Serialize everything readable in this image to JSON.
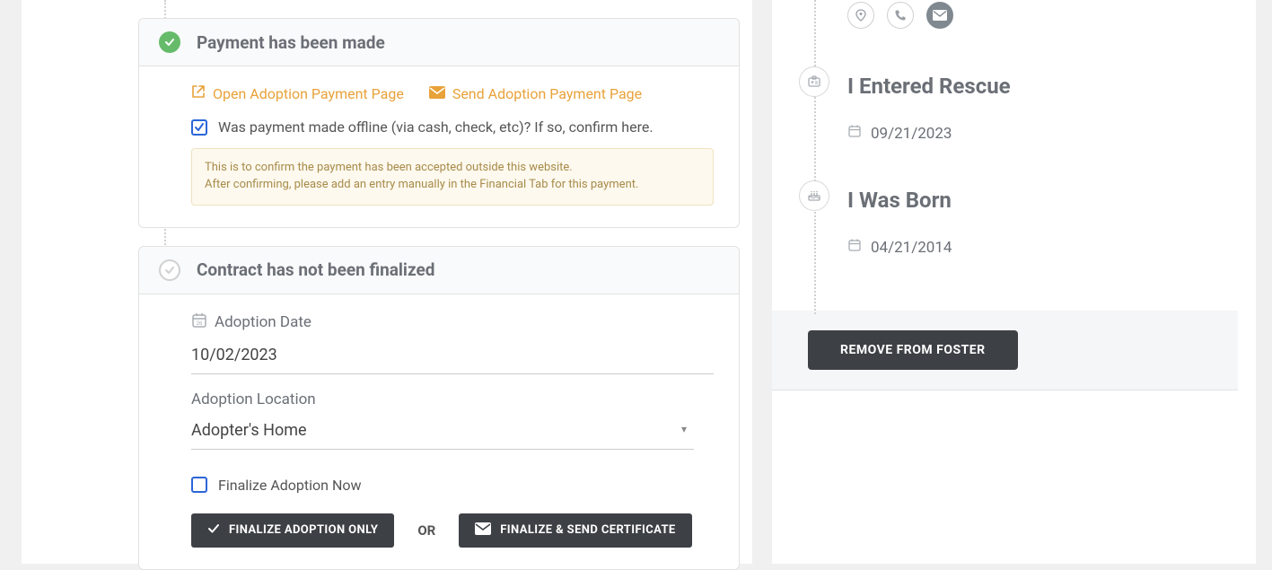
{
  "payment_card": {
    "title": "Payment has been made",
    "open_link": "Open Adoption Payment Page",
    "send_link": "Send Adoption Payment Page",
    "offline_label": "Was payment made offline (via cash, check, etc)? If so, confirm here.",
    "info_line1": "This is to confirm the payment has been accepted outside this website.",
    "info_line2": "After confirming, please add an entry manually in the Financial Tab for this payment."
  },
  "contract_card": {
    "title": "Contract has not been finalized",
    "date_label": "Adoption Date",
    "date_value": "10/02/2023",
    "location_label": "Adoption Location",
    "location_value": "Adopter's Home",
    "finalize_now_label": "Finalize Adoption Now",
    "btn_only": "FINALIZE ADOPTION ONLY",
    "or": "OR",
    "btn_send": "FINALIZE & SEND CERTIFICATE"
  },
  "sidebar": {
    "rescue_title": "I Entered Rescue",
    "rescue_date": "09/21/2023",
    "born_title": "I Was Born",
    "born_date": "04/21/2014",
    "remove_foster": "REMOVE FROM FOSTER"
  }
}
